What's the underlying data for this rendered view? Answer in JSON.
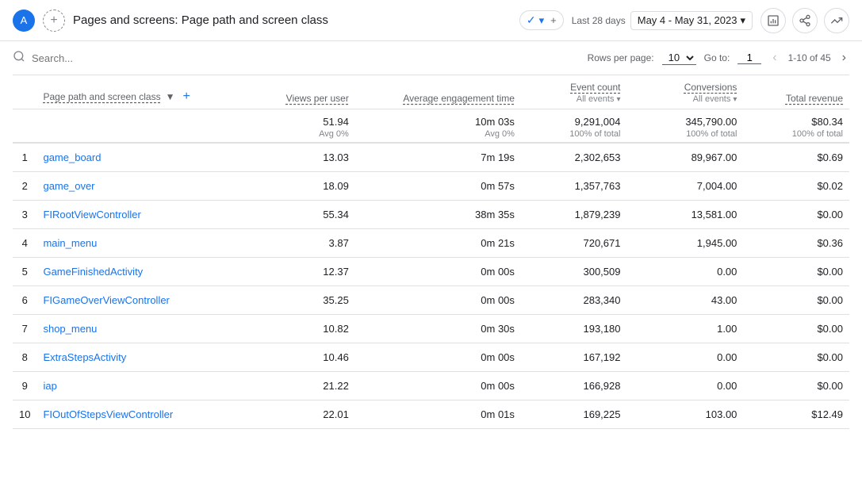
{
  "header": {
    "avatar_letter": "A",
    "add_circle_label": "+",
    "title": "Pages and screens: Page path and screen class",
    "badge_label": "✓",
    "date_last": "Last 28 days",
    "date_range": "May 4 - May 31, 2023",
    "icon_report": "📊",
    "icon_share": "⬆",
    "icon_trend": "📈"
  },
  "search": {
    "placeholder": "Search..."
  },
  "pagination": {
    "rows_per_page_label": "Rows per page:",
    "rows_per_page_value": "10",
    "goto_label": "Go to:",
    "goto_value": "1",
    "range_label": "1-10 of 45"
  },
  "table": {
    "columns": {
      "page_path": {
        "label": "Page path and screen class",
        "sort_icon": "▼"
      },
      "views_per_user": {
        "label": "Views per user"
      },
      "avg_engagement": {
        "label": "Average engagement time"
      },
      "event_count": {
        "label": "Event count",
        "filter": "All events",
        "filter_arrow": "▾"
      },
      "conversions": {
        "label": "Conversions",
        "filter": "All events",
        "filter_arrow": "▾"
      },
      "total_revenue": {
        "label": "Total revenue"
      }
    },
    "totals": {
      "views_per_user": "51.94",
      "views_per_user_sub": "Avg 0%",
      "avg_engagement": "10m 03s",
      "avg_engagement_sub": "Avg 0%",
      "event_count": "9,291,004",
      "event_count_sub": "100% of total",
      "conversions": "345,790.00",
      "conversions_sub": "100% of total",
      "total_revenue": "$80.34",
      "total_revenue_sub": "100% of total"
    },
    "rows": [
      {
        "num": "1",
        "page": "game_board",
        "views": "13.03",
        "avg_eng": "7m 19s",
        "events": "2,302,653",
        "conv": "89,967.00",
        "revenue": "$0.69"
      },
      {
        "num": "2",
        "page": "game_over",
        "views": "18.09",
        "avg_eng": "0m 57s",
        "events": "1,357,763",
        "conv": "7,004.00",
        "revenue": "$0.02"
      },
      {
        "num": "3",
        "page": "FIRootViewController",
        "views": "55.34",
        "avg_eng": "38m 35s",
        "events": "1,879,239",
        "conv": "13,581.00",
        "revenue": "$0.00"
      },
      {
        "num": "4",
        "page": "main_menu",
        "views": "3.87",
        "avg_eng": "0m 21s",
        "events": "720,671",
        "conv": "1,945.00",
        "revenue": "$0.36"
      },
      {
        "num": "5",
        "page": "GameFinishedActivity",
        "views": "12.37",
        "avg_eng": "0m 00s",
        "events": "300,509",
        "conv": "0.00",
        "revenue": "$0.00"
      },
      {
        "num": "6",
        "page": "FIGameOverViewController",
        "views": "35.25",
        "avg_eng": "0m 00s",
        "events": "283,340",
        "conv": "43.00",
        "revenue": "$0.00"
      },
      {
        "num": "7",
        "page": "shop_menu",
        "views": "10.82",
        "avg_eng": "0m 30s",
        "events": "193,180",
        "conv": "1.00",
        "revenue": "$0.00"
      },
      {
        "num": "8",
        "page": "ExtraStepsActivity",
        "views": "10.46",
        "avg_eng": "0m 00s",
        "events": "167,192",
        "conv": "0.00",
        "revenue": "$0.00"
      },
      {
        "num": "9",
        "page": "iap",
        "views": "21.22",
        "avg_eng": "0m 00s",
        "events": "166,928",
        "conv": "0.00",
        "revenue": "$0.00"
      },
      {
        "num": "10",
        "page": "FIOutOfStepsViewController",
        "views": "22.01",
        "avg_eng": "0m 01s",
        "events": "169,225",
        "conv": "103.00",
        "revenue": "$12.49"
      }
    ]
  }
}
